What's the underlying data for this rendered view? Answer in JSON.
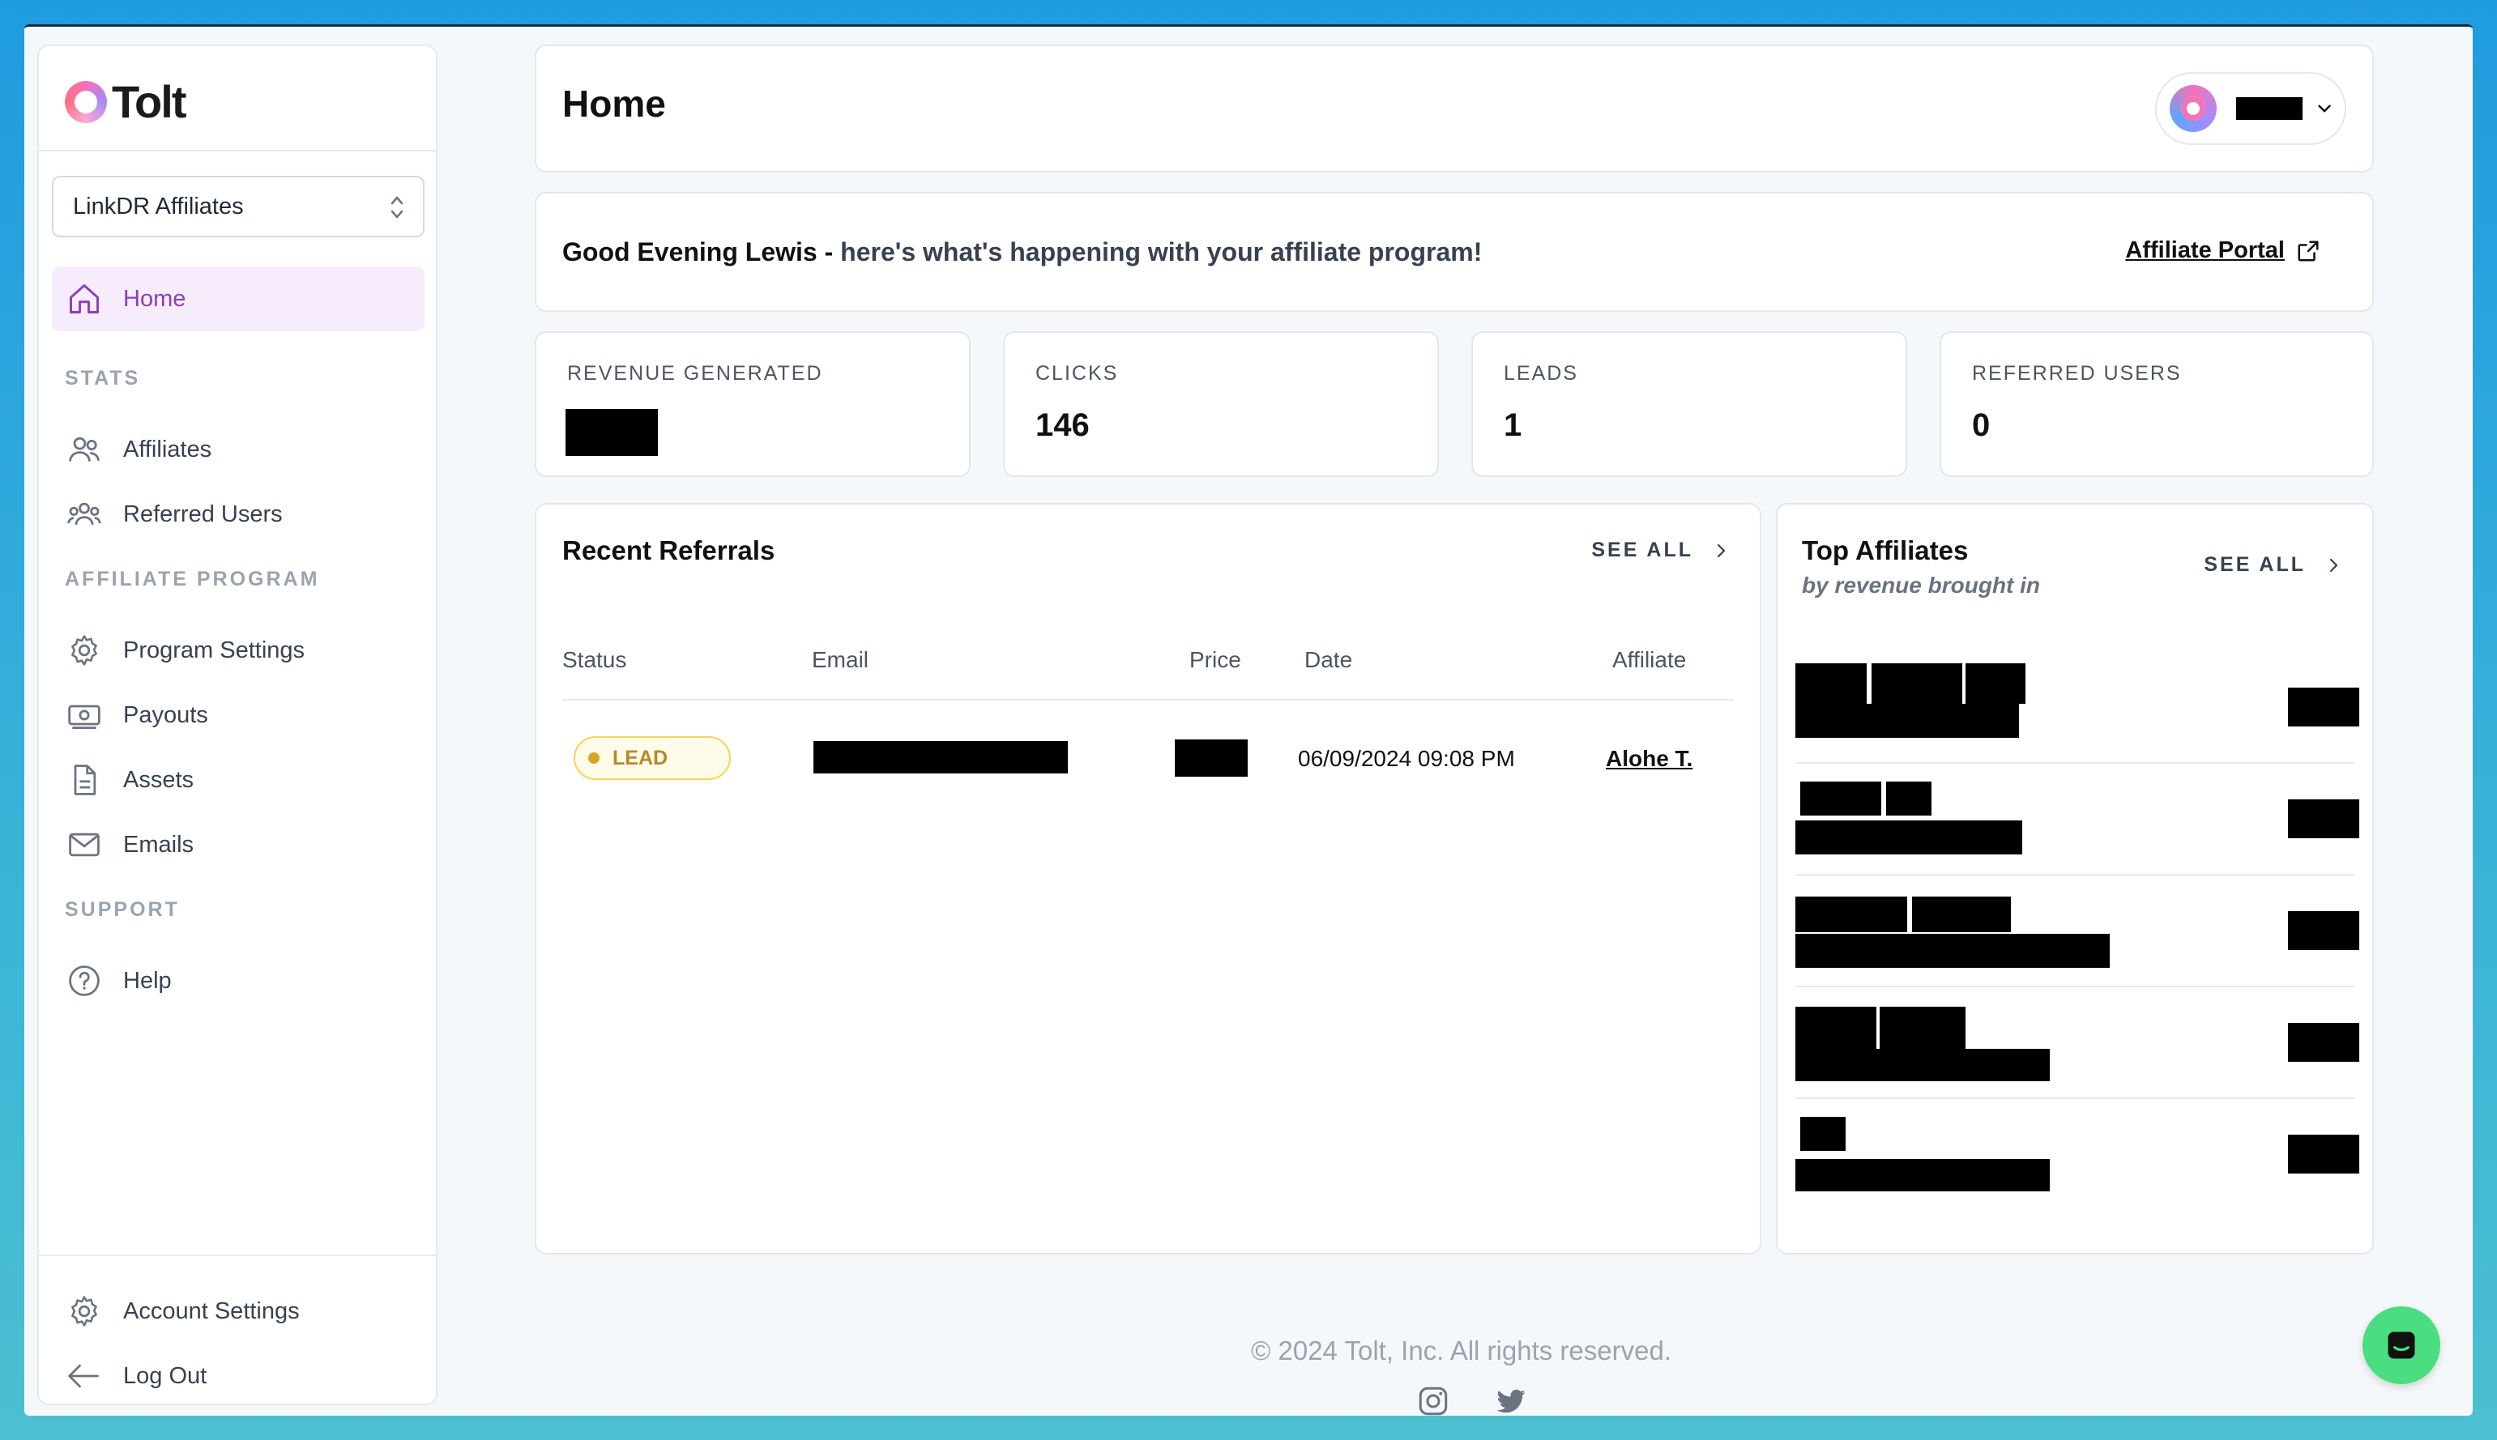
{
  "brand": {
    "name": "Tolt"
  },
  "program_select": {
    "value": "LinkDR Affiliates"
  },
  "nav": {
    "home": "Home",
    "stats_section": "STATS",
    "affiliates": "Affiliates",
    "referred_users": "Referred Users",
    "affiliate_program_section": "AFFILIATE PROGRAM",
    "program_settings": "Program Settings",
    "payouts": "Payouts",
    "assets": "Assets",
    "emails": "Emails",
    "support_section": "SUPPORT",
    "help": "Help",
    "account_settings": "Account Settings",
    "log_out": "Log Out"
  },
  "header": {
    "title": "Home"
  },
  "greeting": {
    "bold": "Good Evening Lewis - ",
    "rest": "here's what's happening with your affiliate program!",
    "portal_link": "Affiliate Portal"
  },
  "stats": [
    {
      "label": "REVENUE GENERATED",
      "value": ""
    },
    {
      "label": "CLICKS",
      "value": "146"
    },
    {
      "label": "LEADS",
      "value": "1"
    },
    {
      "label": "REFERRED USERS",
      "value": "0"
    }
  ],
  "recent_referrals": {
    "title": "Recent Referrals",
    "see_all": "SEE ALL",
    "columns": [
      "Status",
      "Email",
      "Price",
      "Date",
      "Affiliate"
    ],
    "rows": [
      {
        "status": "LEAD",
        "date": "06/09/2024 09:08 PM",
        "affiliate": "Alohe T."
      }
    ]
  },
  "top_affiliates": {
    "title": "Top Affiliates",
    "subtitle": "by revenue brought in",
    "see_all": "SEE ALL"
  },
  "footer": {
    "copyright": "© 2024 Tolt, Inc. All rights reserved."
  },
  "colors": {
    "accent": "#8b3fb8",
    "chat": "#4ade80",
    "lead_badge": "#d9a521"
  }
}
